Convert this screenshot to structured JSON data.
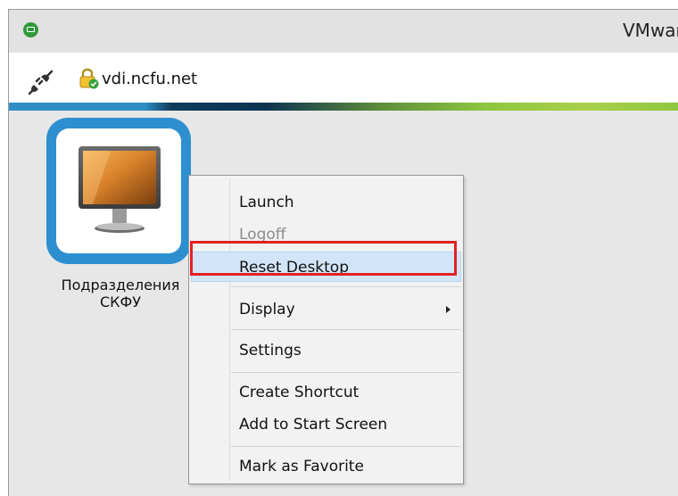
{
  "window": {
    "title": "VMwar"
  },
  "address": {
    "server": "vdi.ncfu.net"
  },
  "tile": {
    "name_line1": "Подразделения",
    "name_line2": "СКФУ"
  },
  "menu": {
    "items": [
      {
        "label": "Launch",
        "disabled": false
      },
      {
        "label": "Logoff",
        "disabled": true
      },
      {
        "label": "Reset Desktop",
        "disabled": false,
        "highlighted": true
      },
      {
        "label": "Display",
        "disabled": false,
        "submenu": true
      },
      {
        "label": "Settings",
        "disabled": false
      },
      {
        "label": "Create Shortcut",
        "disabled": false
      },
      {
        "label": "Add to Start Screen",
        "disabled": false
      },
      {
        "label": "Mark as Favorite",
        "disabled": false
      }
    ]
  },
  "colors": {
    "tile_border": "#2d8fd0",
    "menu_highlight": "#d2e5f8",
    "annotation": "#e32121",
    "app_icon": "#2f9a3b"
  },
  "icons": [
    "app-icon",
    "plug-icon",
    "lock-icon",
    "monitor-icon",
    "chevron-right-icon"
  ]
}
